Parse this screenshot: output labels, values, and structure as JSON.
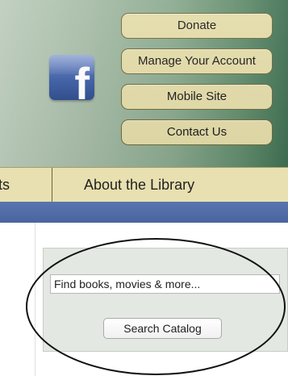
{
  "header": {
    "social": {
      "icon": "facebook-icon",
      "glyph": "f"
    },
    "buttons": [
      {
        "label": "Donate"
      },
      {
        "label": "Manage Your Account"
      },
      {
        "label": "Mobile Site"
      },
      {
        "label": "Contact Us"
      }
    ]
  },
  "nav": {
    "partial_item": "ts",
    "items": [
      {
        "label": "About the Library"
      }
    ]
  },
  "search": {
    "placeholder": "Find books, movies & more...",
    "button_label": "Search Catalog"
  },
  "colors": {
    "button_bg": "#e4dca9",
    "nav_bg": "#e8e0b0",
    "blue_bar": "#4a64a0",
    "search_panel_bg": "#e3e8e2",
    "facebook_blue": "#3e5fa6"
  }
}
